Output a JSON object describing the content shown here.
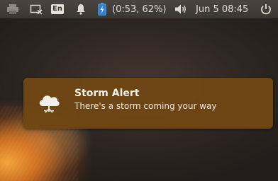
{
  "topbar": {
    "keyboard_layout": "En",
    "battery_status": "(0:53, 62%)",
    "clock": "Jun  5 08:45",
    "icons": [
      "printer-icon",
      "display-icon",
      "keyboard-layout-icon",
      "bell-icon",
      "battery-charging-icon",
      "volume-icon",
      "power-icon"
    ]
  },
  "notification": {
    "icon": "storm-cloud-icon",
    "title": "Storm Alert",
    "body": "There's a storm coming your way"
  },
  "colors": {
    "panel": "#3f3b37",
    "notification_bg": "#704614",
    "text": "#f5f2ea"
  }
}
